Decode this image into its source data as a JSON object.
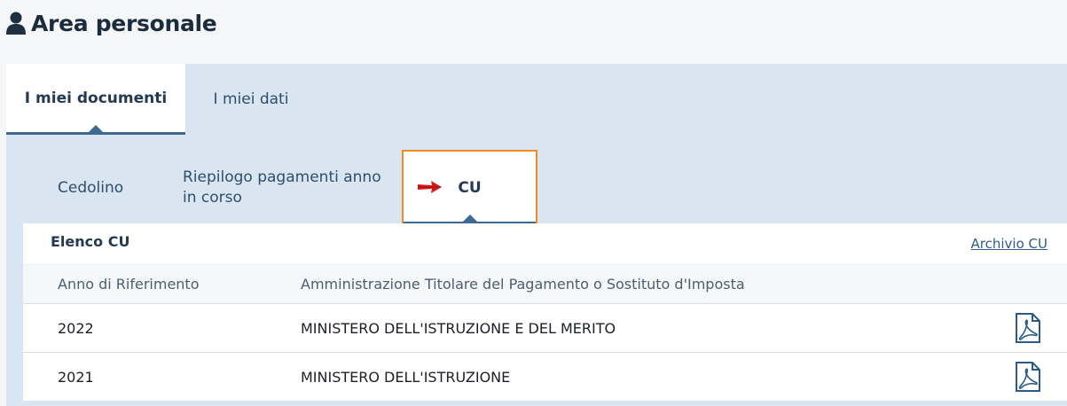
{
  "header": {
    "title": "Area personale",
    "icon": "user-icon"
  },
  "main_tabs": [
    {
      "label": "I miei documenti",
      "active": true
    },
    {
      "label": "I miei dati",
      "active": false
    }
  ],
  "sub_tabs": [
    {
      "label": "Cedolino",
      "active": false
    },
    {
      "label": "Riepilogo pagamenti anno in corso",
      "active": false
    },
    {
      "label": "CU",
      "active": true
    }
  ],
  "card": {
    "title": "Elenco CU",
    "archive_link": "Archivio CU",
    "columns": [
      "Anno di Riferimento",
      "Amministrazione Titolare del Pagamento o Sostituto d'Imposta"
    ],
    "rows": [
      {
        "year": "2022",
        "admin": "MINISTERO DELL'ISTRUZIONE E DEL MERITO",
        "icon": "pdf-icon"
      },
      {
        "year": "2021",
        "admin": "MINISTERO DELL'ISTRUZIONE",
        "icon": "pdf-icon"
      }
    ]
  },
  "colors": {
    "accent": "#3d6a93",
    "highlight_border": "#f08c1e",
    "panel_bg": "#d9e5f0",
    "arrow": "#d61a1a"
  }
}
